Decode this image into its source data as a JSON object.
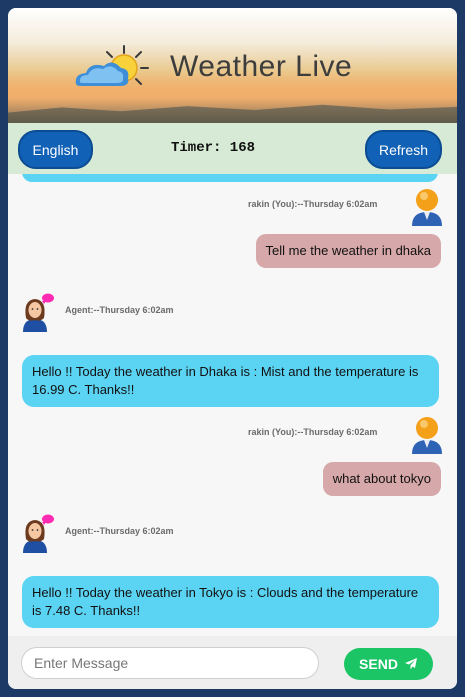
{
  "header": {
    "logo_text": "Weather Live",
    "logo_icon": "sun-cloud-icon"
  },
  "toolbar": {
    "language_label": "English",
    "timer_label": "Timer: 168",
    "refresh_label": "Refresh"
  },
  "messages": [
    {
      "sender": "user",
      "meta": "rakin (You):--Thursday 6:02am",
      "text": "Tell me the weather in dhaka"
    },
    {
      "sender": "agent",
      "meta": "Agent:--Thursday 6:02am",
      "text": "Hello !! Today the weather in Dhaka is : Mist and the temperature is 16.99 C. Thanks!!"
    },
    {
      "sender": "user",
      "meta": "rakin (You):--Thursday 6:02am",
      "text": "what about tokyo"
    },
    {
      "sender": "agent",
      "meta": "Agent:--Thursday 6:02am",
      "text": "Hello !! Today the weather in Tokyo is : Clouds and the temperature is 7.48 C. Thanks!!"
    }
  ],
  "composer": {
    "placeholder": "Enter Message",
    "value": "",
    "send_label": "SEND",
    "send_icon": "paper-plane-icon"
  },
  "colors": {
    "page_bg": "#1d3a66",
    "accent_blue": "#1161b6",
    "user_bubble": "#d6a8a9",
    "agent_bubble": "#5bd3f3",
    "send_green": "#1bc464"
  }
}
